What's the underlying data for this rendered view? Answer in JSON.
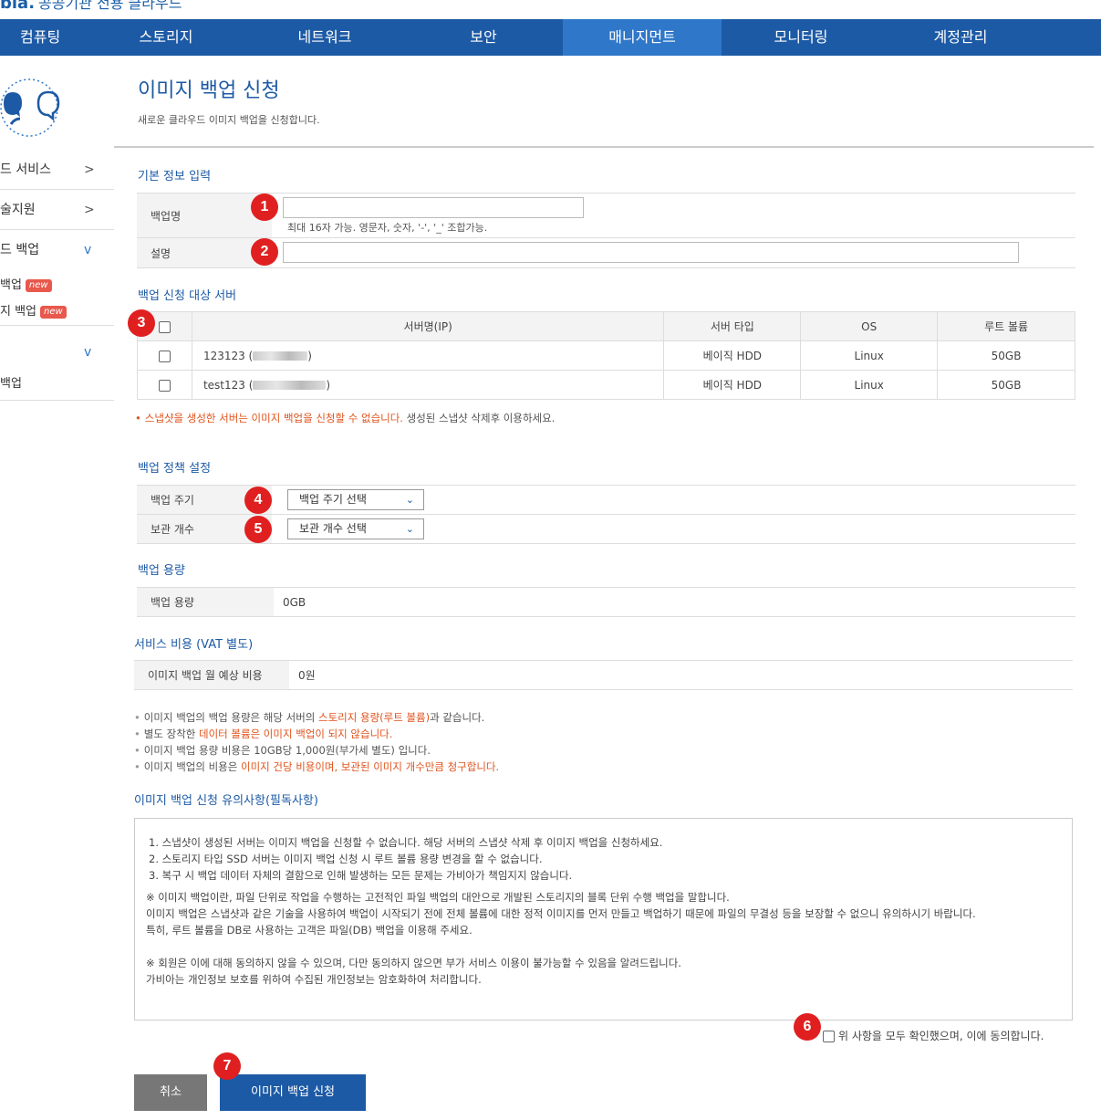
{
  "brand": {
    "logo_text": "bia.",
    "logo_sub": "공공기관 전용 클라우드"
  },
  "gnb": [
    {
      "label": "컴퓨팅"
    },
    {
      "label": "스토리지"
    },
    {
      "label": "네트워크"
    },
    {
      "label": "보안"
    },
    {
      "label": "매니지먼트"
    },
    {
      "label": "모니터링"
    },
    {
      "label": "계정관리"
    }
  ],
  "lnb": {
    "items": [
      {
        "label": "드 서비스",
        "arrow": ">"
      },
      {
        "label": "술지원",
        "arrow": ">"
      },
      {
        "label": "드 백업",
        "arrow": "v"
      }
    ],
    "subs": [
      {
        "label": "백업",
        "badge": "new"
      },
      {
        "label": "지 백업",
        "badge": "new"
      }
    ],
    "group2_arrow": "v",
    "group2_sub": "백업"
  },
  "page": {
    "title": "이미지 백업 신청",
    "desc": "새로운 클라우드 이미지 백업을 신청합니다."
  },
  "basic": {
    "title": "기본 정보 입력",
    "name_label": "백업명",
    "name_value": "",
    "name_help": "최대 16자 가능. 영문자, 숫자, '-', '_' 조합가능.",
    "desc_label": "설명",
    "desc_value": ""
  },
  "servers": {
    "title": "백업 신청 대상 서버",
    "columns": [
      "서버명(IP)",
      "서버 타입",
      "OS",
      "루트 볼륨"
    ],
    "rows": [
      {
        "name": "123123 (",
        "close": ")",
        "type": "베이직 HDD",
        "os": "Linux",
        "volume": "50GB"
      },
      {
        "name": "test123 (",
        "close": ")",
        "type": "베이직 HDD",
        "os": "Linux",
        "volume": "50GB"
      }
    ],
    "note_hl": "스냅샷을 생성한 서버는 이미지 백업을 신청할 수 없습니다.",
    "note_rest": " 생성된 스냅샷 삭제후 이용하세요."
  },
  "policy": {
    "title": "백업 정책 설정",
    "cycle_label": "백업 주기",
    "cycle_value": "백업 주기 선택",
    "keep_label": "보관 개수",
    "keep_value": "보관 개수 선택"
  },
  "capacity": {
    "title": "백업 용량",
    "label": "백업 용량",
    "value": "0GB"
  },
  "cost": {
    "title": "서비스 비용 (VAT 별도)",
    "label": "이미지 백업 월 예상 비용",
    "value": "0원"
  },
  "notes": [
    {
      "pre": "이미지 백업의 백업 용량은 해당 서버의 ",
      "hl": "스토리지 용량(루트 볼륨)",
      "post": "과 같습니다."
    },
    {
      "pre": "별도 장착한 ",
      "hl": "데이터 볼륨은 이미지 백업이 되지 않습니다.",
      "post": ""
    },
    {
      "pre": "이미지 백업 용량 비용은 10GB당 1,000원(부가세 별도) 입니다.",
      "hl": "",
      "post": ""
    },
    {
      "pre": "이미지 백업의 비용은 ",
      "hl": "이미지 건당 비용이며, 보관된 이미지 개수만큼 청구합니다.",
      "post": ""
    }
  ],
  "terms": {
    "title": "이미지 백업 신청 유의사항(필독사항)",
    "lines": [
      "1. 스냅샷이 생성된 서버는 이미지 백업을 신청할 수 없습니다. 해당 서버의 스냅샷 삭제 후 이미지 백업을 신청하세요.",
      "2. 스토리지 타입 SSD 서버는 이미지 백업 신청 시 루트 볼륨 용량 변경을 할 수 없습니다.",
      "3. 복구 시 백업 데이터 자체의 결함으로 인해 발생하는 모든 문제는 가비아가 책임지지 않습니다.",
      "",
      "※ 이미지 백업이란, 파일 단위로 작업을 수행하는 고전적인 파일 백업의 대안으로 개발된 스토리지의 블록 단위 수행 백업을 말합니다.",
      "이미지 백업은 스냅샷과 같은 기술을 사용하여 백업이 시작되기 전에 전체 볼륨에 대한 정적 이미지를 먼저 만들고 백업하기 때문에 파일의 무결성 등을 보장할 수 없으니 유의하시기 바랍니다.",
      "특히, 루트 볼륨을 DB로 사용하는 고객은 파일(DB) 백업을 이용해 주세요.",
      "",
      "※ 회원은 이에 대해 동의하지 않을 수 있으며, 다만 동의하지 않으면 부가 서비스 이용이 불가능할 수 있음을 알려드립니다.",
      "가비아는 개인정보 보호를 위하여 수집된 개인정보는 암호화하여 처리합니다."
    ],
    "agree_label": "위 사항을 모두 확인했으며, 이에 동의합니다."
  },
  "buttons": {
    "cancel": "취소",
    "submit": "이미지 백업 신청"
  },
  "markers": [
    "1",
    "2",
    "3",
    "4",
    "5",
    "6",
    "7"
  ],
  "colors": {
    "brand": "#1d5aa5",
    "active_tab": "#2f77c9",
    "highlight": "#e0541e",
    "marker": "#e02020"
  }
}
